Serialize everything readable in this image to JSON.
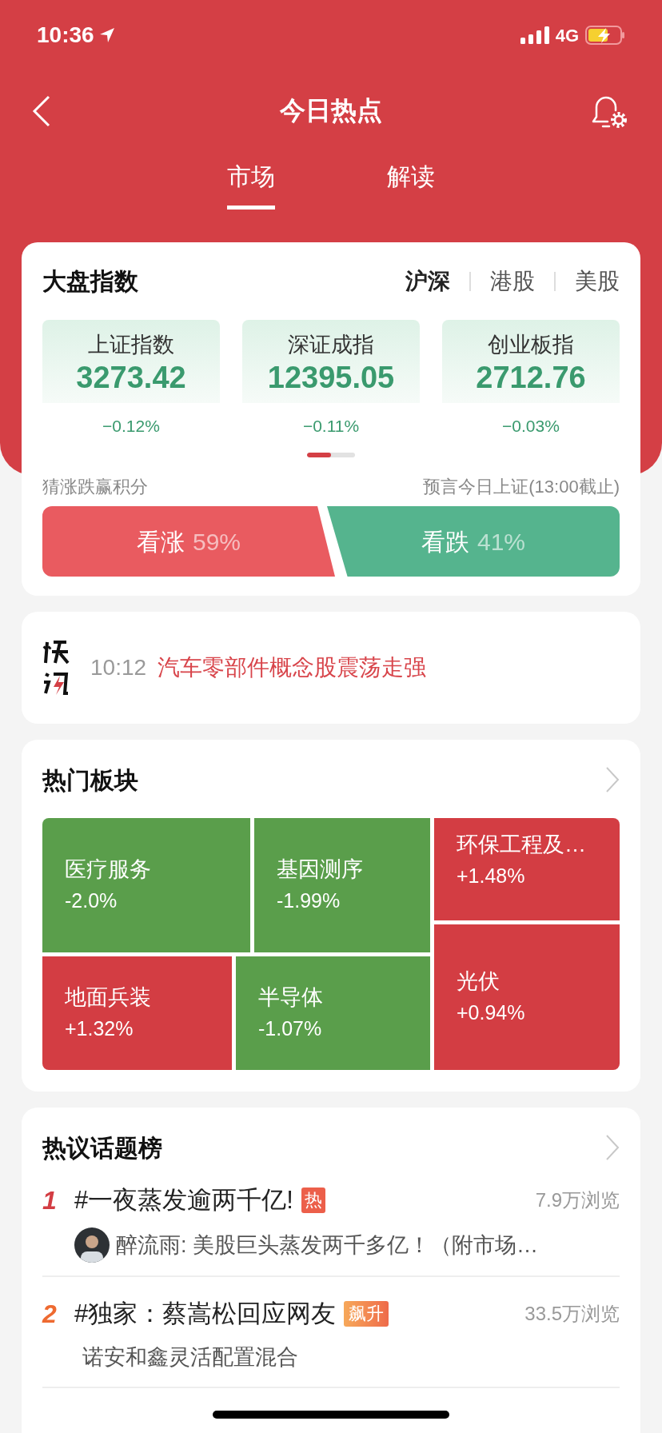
{
  "status_bar": {
    "time": "10:36",
    "network": "4G"
  },
  "nav": {
    "title": "今日热点"
  },
  "tabs": [
    {
      "label": "市场",
      "selected": true
    },
    {
      "label": "解读",
      "selected": false
    }
  ],
  "index_card": {
    "title": "大盘指数",
    "markets": [
      {
        "label": "沪深",
        "selected": true
      },
      {
        "label": "港股",
        "selected": false
      },
      {
        "label": "美股",
        "selected": false
      }
    ],
    "indices": [
      {
        "name": "上证指数",
        "value": "3273.42",
        "change": "−0.12%"
      },
      {
        "name": "深证成指",
        "value": "12395.05",
        "change": "−0.11%"
      },
      {
        "name": "创业板指",
        "value": "2712.76",
        "change": "−0.03%"
      }
    ],
    "pager": [
      {
        "selected": true
      },
      {
        "selected": false
      }
    ],
    "guess_label": "猜涨跌赢积分",
    "predict_label": "预言今日上证(13:00截止)",
    "votes": [
      {
        "kind": "up",
        "label": "看涨",
        "share": "59%"
      },
      {
        "kind": "down",
        "label": "看跌",
        "share": "41%"
      }
    ]
  },
  "flash": {
    "time": "10:12",
    "headline": "汽车零部件概念股震荡走强"
  },
  "sectors": {
    "title": "热门板块",
    "items": [
      {
        "name": "医疗服务",
        "change": "-2.0%",
        "rising": false
      },
      {
        "name": "基因测序",
        "change": "-1.99%",
        "rising": false
      },
      {
        "name": "环保工程及…",
        "change": "+1.48%",
        "rising": true
      },
      {
        "name": "地面兵装",
        "change": "+1.32%",
        "rising": true
      },
      {
        "name": "半导体",
        "change": "-1.07%",
        "rising": false
      },
      {
        "name": "光伏",
        "change": "+0.94%",
        "rising": true
      }
    ]
  },
  "topics": {
    "title": "热议话题榜",
    "items": [
      {
        "rank": "1",
        "title": "#一夜蒸发逾两千亿!",
        "tag": {
          "kind": "hot",
          "label": "热"
        },
        "views": "7.9万浏览",
        "subtitle": "醉流雨: 美股巨头蒸发两千多亿！（附市场…",
        "avatar": true
      },
      {
        "rank": "2",
        "title": "#独家：蔡嵩松回应网友",
        "tag": {
          "kind": "rising",
          "label": "飙升"
        },
        "views": "33.5万浏览",
        "subtitle": "诺安和鑫灵活配置混合",
        "avatar": false
      }
    ]
  }
}
